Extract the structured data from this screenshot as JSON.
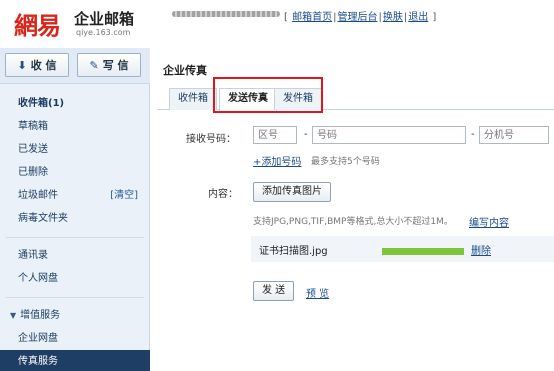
{
  "brand": {
    "mark": "網易",
    "title": "企业邮箱",
    "subtitle": "qiye.163.com"
  },
  "toplinks": {
    "items": [
      "邮箱首页",
      "管理后台",
      "换肤",
      "退出"
    ]
  },
  "sidebar": {
    "receive_label": "收 信",
    "write_label": "写 信",
    "items": [
      {
        "label": "收件箱(1)"
      },
      {
        "label": "草稿箱"
      },
      {
        "label": "已发送"
      },
      {
        "label": "已删除"
      },
      {
        "label": "垃圾邮件",
        "extra": "[清空]"
      },
      {
        "label": "病毒文件夹"
      },
      {
        "label": "通讯录"
      },
      {
        "label": "个人网盘"
      },
      {
        "label": "增值服务"
      },
      {
        "label": "企业网盘"
      },
      {
        "label": "传真服务"
      }
    ]
  },
  "main": {
    "title": "企业传真",
    "tabs": [
      "收件箱",
      "发送传真",
      "发件箱"
    ],
    "active_tab": "发送传真",
    "form": {
      "recipient_label": "接收号码：",
      "area_placeholder": "区号",
      "number_placeholder": "号码",
      "ext_placeholder": "分机号",
      "add_number_link": "+添加号码",
      "add_number_hint": "最多支持5个号码",
      "content_label": "内容：",
      "add_image_button": "添加传真图片",
      "format_hint": "支持JPG,PNG,TIF,BMP等格式,总大小不超过1M。",
      "edit_content_link": "编写内容",
      "file": {
        "name": "证书扫描图.jpg",
        "progress": 1.0,
        "delete_label": "删除"
      },
      "send_button": "发 送",
      "preview_link": "预 览"
    }
  },
  "colors": {
    "brand_red": "#d8261a",
    "sidebar_bg": "#eaf1f8",
    "active_nav": "#1f3e66",
    "highlight": "#e0161e",
    "progress": "#7cc43a",
    "link": "#1a4c8b"
  }
}
